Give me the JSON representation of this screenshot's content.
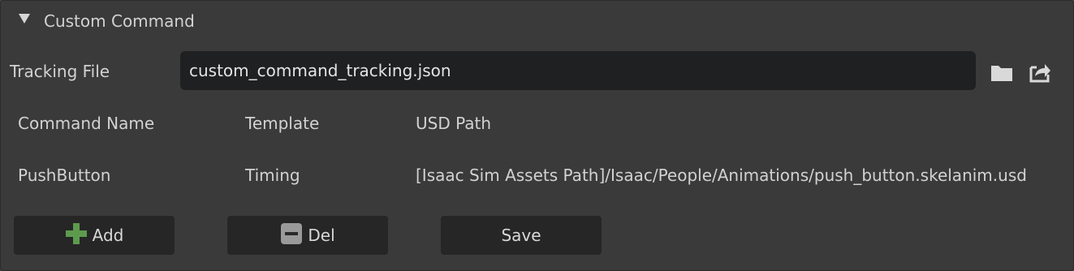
{
  "panel": {
    "title": "Custom Command"
  },
  "tracking": {
    "label": "Tracking File",
    "value": "custom_command_tracking.json",
    "icons": [
      "folder-icon",
      "export-icon"
    ]
  },
  "table": {
    "headers": [
      "Command Name",
      "Template",
      "USD Path"
    ],
    "rows": [
      [
        "PushButton",
        "Timing",
        "[Isaac Sim Assets Path]/Isaac/People/Animations/push_button.skelanim.usd"
      ]
    ]
  },
  "buttons": {
    "add": "Add",
    "del": "Del",
    "save": "Save"
  },
  "colors": {
    "add_icon": "#5e9a4e",
    "del_icon": "#9a9a9a",
    "accent_text": "#d2d2d2"
  }
}
